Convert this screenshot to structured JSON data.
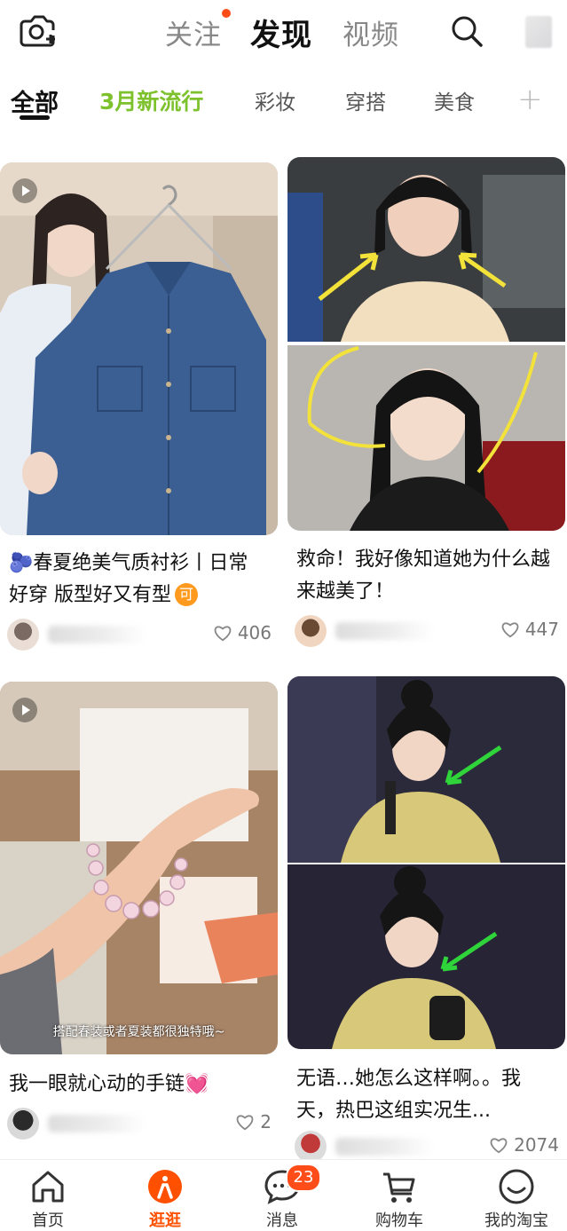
{
  "header": {
    "tabs": [
      {
        "label": "关注",
        "has_dot": true
      },
      {
        "label": "发现",
        "active": true
      },
      {
        "label": "视频"
      }
    ],
    "icons": {
      "camera": "camera-plus-icon",
      "search": "search-icon"
    }
  },
  "categories": {
    "items": [
      {
        "label": "全部",
        "active": true
      },
      {
        "label": "3月新流行",
        "highlight": true
      },
      {
        "label": "彩妆"
      },
      {
        "label": "穿搭"
      },
      {
        "label": "美食"
      }
    ],
    "add_label": "+"
  },
  "colors": {
    "accent": "#ff5000",
    "green": "#7dc22d",
    "badge": "#ff4d1a"
  },
  "cards": [
    {
      "title": "🫐春夏绝美气质衬衫丨日常好穿 版型好又有型",
      "badge_char": "可",
      "likes": "406",
      "has_video": true
    },
    {
      "title": "救命！我好像知道她为什么越来越美了！",
      "likes": "447",
      "has_video": false
    },
    {
      "title": "我一眼就心动的手链💓",
      "likes": "2",
      "caption": "搭配春装或者夏装都很独特哦~",
      "has_video": true
    },
    {
      "title": "无语…她怎么这样啊。。我天，热巴这组实况生...",
      "likes": "2074",
      "has_video": false
    }
  ],
  "bottom_nav": {
    "items": [
      {
        "label": "首页",
        "icon": "home-icon"
      },
      {
        "label": "逛逛",
        "icon": "guangguang-icon",
        "active": true
      },
      {
        "label": "消息",
        "icon": "message-icon",
        "badge": "23"
      },
      {
        "label": "购物车",
        "icon": "cart-icon"
      },
      {
        "label": "我的淘宝",
        "icon": "smile-icon"
      }
    ]
  }
}
